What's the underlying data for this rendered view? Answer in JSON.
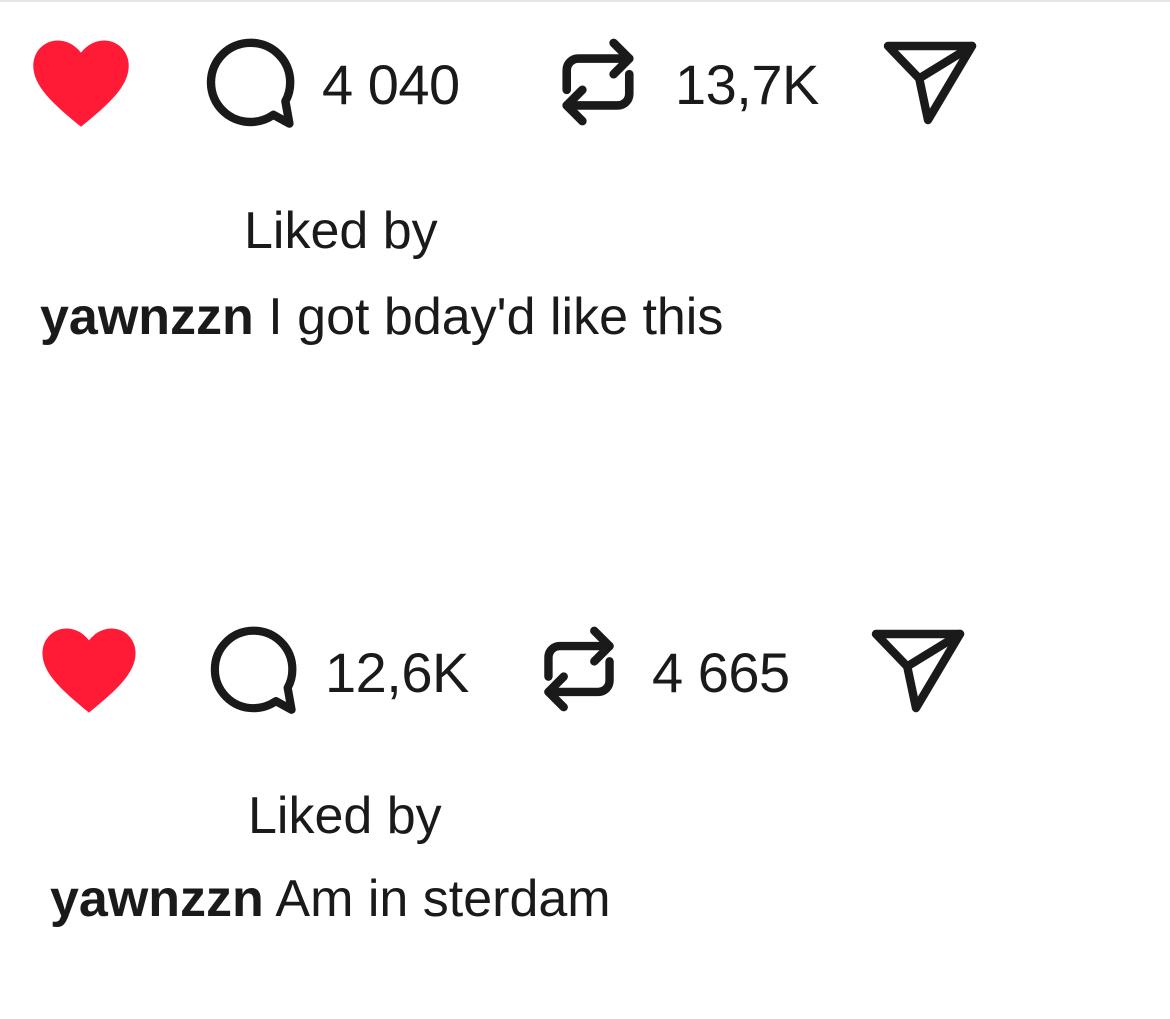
{
  "colors": {
    "like": "#ff1a35",
    "text": "#1a1a1a"
  },
  "posts": [
    {
      "liked": true,
      "comments": "4 040",
      "reposts": "13,7K",
      "liked_by_label": "Liked by",
      "username": "yawnzzn",
      "caption": "I got bday'd like this"
    },
    {
      "liked": true,
      "comments": "12,6K",
      "reposts": "4 665",
      "liked_by_label": "Liked by",
      "username": "yawnzzn",
      "caption": "Am in sterdam"
    }
  ],
  "icons": {
    "like": "heart-icon",
    "comment": "comment-bubble-icon",
    "repost": "repost-icon",
    "share": "send-icon"
  }
}
